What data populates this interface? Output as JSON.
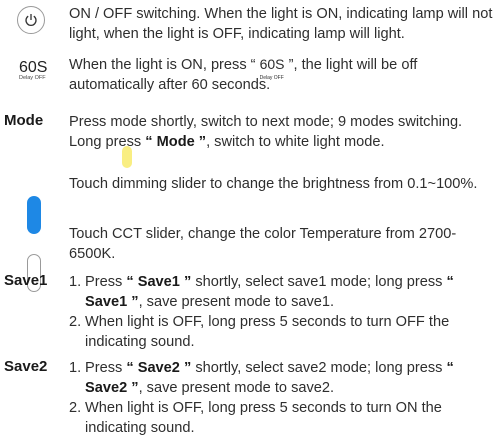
{
  "power": {
    "icon": "power-icon",
    "text": "ON / OFF switching. When the light is ON, indicating lamp will not light, when the light is OFF, indicating lamp will light."
  },
  "delay": {
    "label": "60S",
    "sublabel": "Delay OFF",
    "text_before": "When the light is ON, press “",
    "text_after": "”, the light will be off automatically after 60 seconds."
  },
  "mode": {
    "label": "Mode",
    "text_1": "Press mode shortly, switch to next mode; 9 modes switching. Long press ",
    "bold": "“ Mode ”",
    "text_2": ", switch to white light mode."
  },
  "dimming": {
    "icon": "brightness-slider-icon",
    "text": "Touch dimming slider to change the brightness from 0.1~100%."
  },
  "cct": {
    "icon": "cct-slider-icon",
    "text": "Touch CCT slider, change the color Temperature from 2700-6500K."
  },
  "save1": {
    "label": "Save1",
    "item1_num": "1.",
    "item1_a": "Press ",
    "item1_b": "“ Save1 ”",
    "item1_c": " shortly, select save1 mode; long press ",
    "item1_d": "“ Save1 ”",
    "item1_e": ", save present mode to save1.",
    "item2_num": "2.",
    "item2": "When light is OFF, long press 5 seconds to turn OFF the indicating sound."
  },
  "save2": {
    "label": "Save2",
    "item1_num": "1.",
    "item1_a": "Press ",
    "item1_b": "“ Save2 ”",
    "item1_c": " shortly, select save2 mode; long press ",
    "item1_d": "“ Save2 ”",
    "item1_e": ", save present mode to save2.",
    "item2_num": "2.",
    "item2": "When light is OFF, long press 5 seconds to turn ON the indicating sound."
  },
  "colors": {
    "dimming_slider": "#1e88e5",
    "touch_knob": "#f8ec74"
  }
}
